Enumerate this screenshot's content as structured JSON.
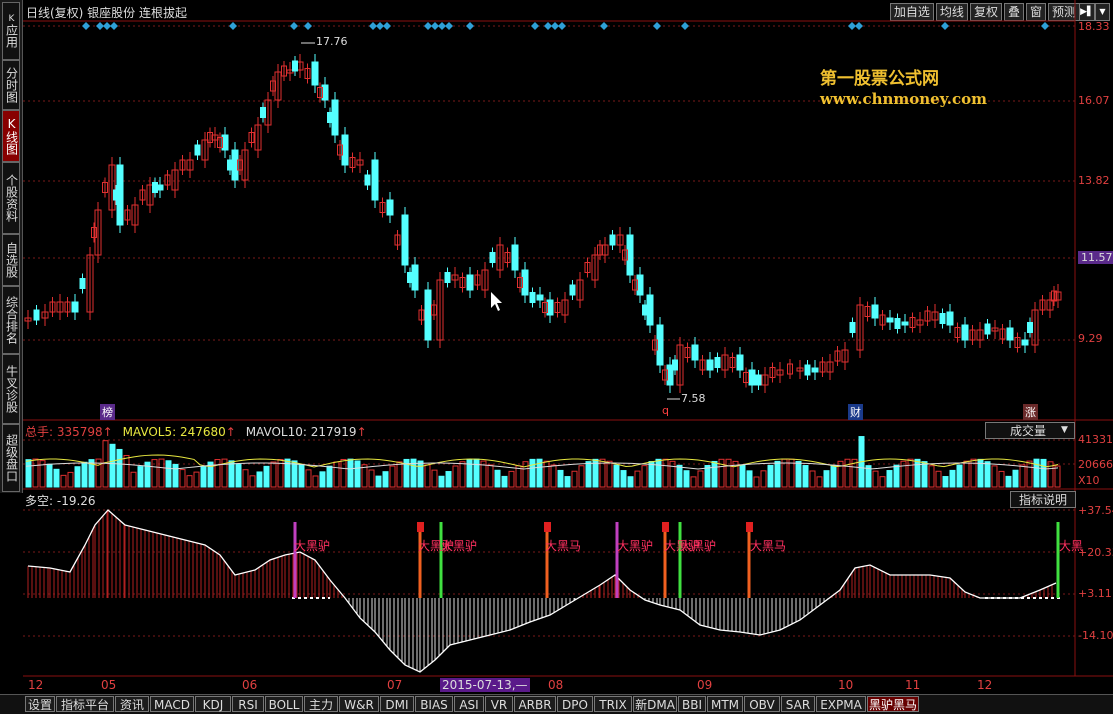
{
  "sidebar": {
    "items": [
      {
        "label": "应用",
        "key_hint": "K"
      },
      {
        "label": "分时图"
      },
      {
        "label": "K线图",
        "key_hint": "K"
      },
      {
        "label": "个股资料"
      },
      {
        "label": "自选股"
      },
      {
        "label": "综合排名"
      },
      {
        "label": "牛叉诊股"
      },
      {
        "label": "超级盘口"
      }
    ]
  },
  "header": {
    "title": "日线(复权)  银座股份  连根拔起",
    "toolbar": [
      "加自选",
      "均线",
      "复权",
      "叠",
      "窗",
      "预测"
    ],
    "nav_arrow": "▶▌",
    "menu_arrow": "▼"
  },
  "watermark": {
    "line1": "第一股票公式网",
    "line2": "www.chnmoney.com"
  },
  "price_axis": {
    "labels": [
      "18.33",
      "16.07",
      "13.82",
      "11.57",
      "9.29"
    ],
    "current": "11.57"
  },
  "price_annotations": {
    "high": "17.76",
    "low": "7.58"
  },
  "event_markers": [
    "榜",
    "q",
    "财",
    "涨"
  ],
  "volume": {
    "total_label": "总手: ",
    "total_value": "335798",
    "mavol5_label": "MAVOL5: ",
    "mavol5_value": "247680",
    "mavol10_label": "MAVOL10: ",
    "mavol10_value": "217919",
    "selector": "成交量",
    "axis": [
      "41331",
      "20666",
      "X10"
    ]
  },
  "indicator": {
    "name_label": "多空: ",
    "value": "-19.26",
    "help_button": "指标说明",
    "axis": [
      "+37.54",
      "+20.33",
      "+3.11",
      "-14.10"
    ],
    "signals": [
      "大黑驴",
      "大黑驴",
      "大黑驴",
      "大黑马",
      "大黑驴",
      "大黑驴",
      "大黑驴",
      "大黑马",
      "大黑"
    ]
  },
  "date_axis": {
    "labels": [
      "12",
      "05",
      "06",
      "07",
      "08",
      "09",
      "10",
      "11",
      "12"
    ],
    "cursor": "2015-07-13,—"
  },
  "bottom_tabs": [
    "设置",
    "指标平台",
    "资讯",
    "MACD",
    "KDJ",
    "RSI",
    "BOLL",
    "主力",
    "W&R",
    "DMI",
    "BIAS",
    "ASI",
    "VR",
    "ARBR",
    "DPO",
    "TRIX",
    "新DMA",
    "BBI",
    "MTM",
    "OBV",
    "SAR",
    "EXPMA",
    "黑驴黑马"
  ],
  "active_bottom_tab": "黑驴黑马",
  "colors": {
    "up": "#e03030",
    "down": "#54ffff",
    "axis_text": "#e04040",
    "watermark": "#f0c030"
  }
}
